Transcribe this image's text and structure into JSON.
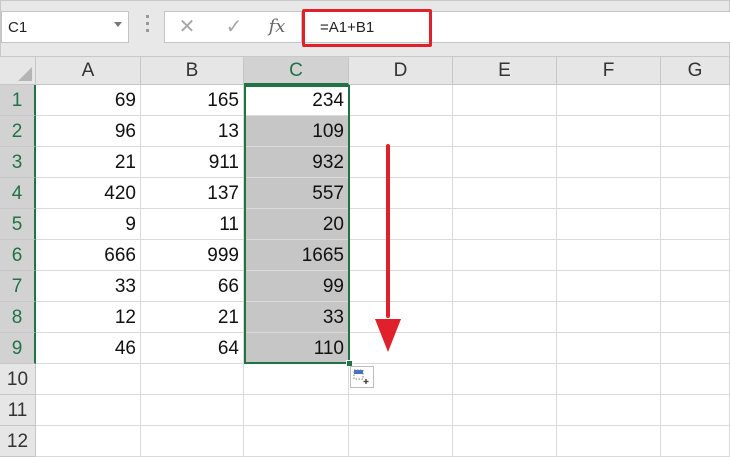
{
  "formula_bar": {
    "name_box": "C1",
    "formula": "=A1+B1",
    "cancel_icon": "x-icon",
    "enter_icon": "check-icon",
    "fx_label": "fx"
  },
  "columns": [
    "A",
    "B",
    "C",
    "D",
    "E",
    "F",
    "G"
  ],
  "rows": [
    {
      "num": "1",
      "a": "69",
      "b": "165",
      "c": "234"
    },
    {
      "num": "2",
      "a": "96",
      "b": "13",
      "c": "109"
    },
    {
      "num": "3",
      "a": "21",
      "b": "911",
      "c": "932"
    },
    {
      "num": "4",
      "a": "420",
      "b": "137",
      "c": "557"
    },
    {
      "num": "5",
      "a": "9",
      "b": "11",
      "c": "20"
    },
    {
      "num": "6",
      "a": "666",
      "b": "999",
      "c": "1665"
    },
    {
      "num": "7",
      "a": "33",
      "b": "66",
      "c": "99"
    },
    {
      "num": "8",
      "a": "12",
      "b": "21",
      "c": "33"
    },
    {
      "num": "9",
      "a": "46",
      "b": "64",
      "c": "110"
    },
    {
      "num": "10",
      "a": "",
      "b": "",
      "c": ""
    },
    {
      "num": "11",
      "a": "",
      "b": "",
      "c": ""
    },
    {
      "num": "12",
      "a": "",
      "b": "",
      "c": ""
    }
  ],
  "selection": {
    "column": "C",
    "first_row": 1,
    "last_row": 9
  },
  "colors": {
    "selection": "#217346",
    "highlight": "#e0202a",
    "selected_fill": "#c6c6c6"
  }
}
